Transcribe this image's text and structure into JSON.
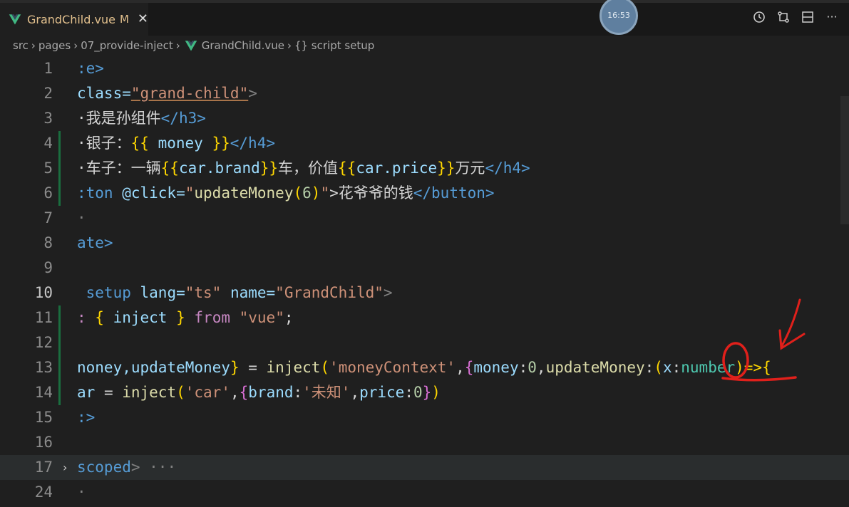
{
  "tab": {
    "file_name": "GrandChild.vue",
    "status": "M",
    "close_glyph": "✕"
  },
  "clock": {
    "time": "16:53"
  },
  "breadcrumb": {
    "items": [
      "src",
      "pages",
      "07_provide-inject",
      "GrandChild.vue",
      "{} script setup"
    ]
  },
  "lines": [
    {
      "num": "1"
    },
    {
      "num": "2"
    },
    {
      "num": "3"
    },
    {
      "num": "4"
    },
    {
      "num": "5"
    },
    {
      "num": "6"
    },
    {
      "num": "7"
    },
    {
      "num": "8"
    },
    {
      "num": "9"
    },
    {
      "num": "10"
    },
    {
      "num": "11"
    },
    {
      "num": "12"
    },
    {
      "num": "13"
    },
    {
      "num": "14"
    },
    {
      "num": "15"
    },
    {
      "num": "16"
    },
    {
      "num": "17"
    },
    {
      "num": "24"
    }
  ],
  "code": {
    "l1": ":e>",
    "l2a": "class=",
    "l2b": "\"grand-child\"",
    "l2c": ">",
    "l3a": "·我是孙组件",
    "l3b": "</h3>",
    "l4a": "·银子：",
    "l4b": "{{",
    "l4c": " money ",
    "l4d": "}}",
    "l4e": "</h4>",
    "l5a": "·车子：一辆",
    "l5b": "{{",
    "l5c": "car.brand",
    "l5d": "}}",
    "l5e": "车，价值",
    "l5f": "{{",
    "l5g": "car.price",
    "l5h": "}}",
    "l5i": "万元",
    "l5j": "</h4>",
    "l6a": ":ton ",
    "l6b": "@click=",
    "l6c": "\"",
    "l6d": "updateMoney",
    "l6e": "(",
    "l6f": "6",
    "l6g": ")",
    "l6h": "\"",
    "l6i": ">花爷爷的钱",
    "l6j": "</button>",
    "l7": "·",
    "l8": "ate>",
    "l10a": " setup ",
    "l10b": "lang=",
    "l10c": "\"ts\"",
    "l10d": " name=",
    "l10e": "\"GrandChild\"",
    "l10f": ">",
    "l11a": ": ",
    "l11b": "{",
    "l11c": " inject ",
    "l11d": "}",
    "l11e": " from ",
    "l11f": "\"vue\"",
    "l11g": ";",
    "l13a": "noney,updateMoney",
    "l13b": "}",
    "l13c": " = ",
    "l13d": "inject",
    "l13e": "(",
    "l13f": "'moneyContext'",
    "l13g": ",",
    "l13h": "{",
    "l13i": "money",
    "l13j": ":",
    "l13k": "0",
    "l13l": ",",
    "l13m": "updateMoney",
    "l13n": ":",
    "l13o": "(",
    "l13p": "x",
    "l13q": ":",
    "l13r": "number",
    "l13s": ")=>",
    "l13t": "{",
    "l14a": "ar",
    "l14b": " = ",
    "l14c": "inject",
    "l14d": "(",
    "l14e": "'car'",
    "l14f": ",",
    "l14g": "{",
    "l14h": "brand",
    "l14i": ":",
    "l14j": "'未知'",
    "l14k": ",",
    "l14l": "price",
    "l14m": ":",
    "l14n": "0",
    "l14o": "}",
    "l14p": ")",
    "l15": ":>",
    "l17a": "scoped",
    "l17b": ">",
    "l17c": " ···",
    "l24": "·"
  }
}
